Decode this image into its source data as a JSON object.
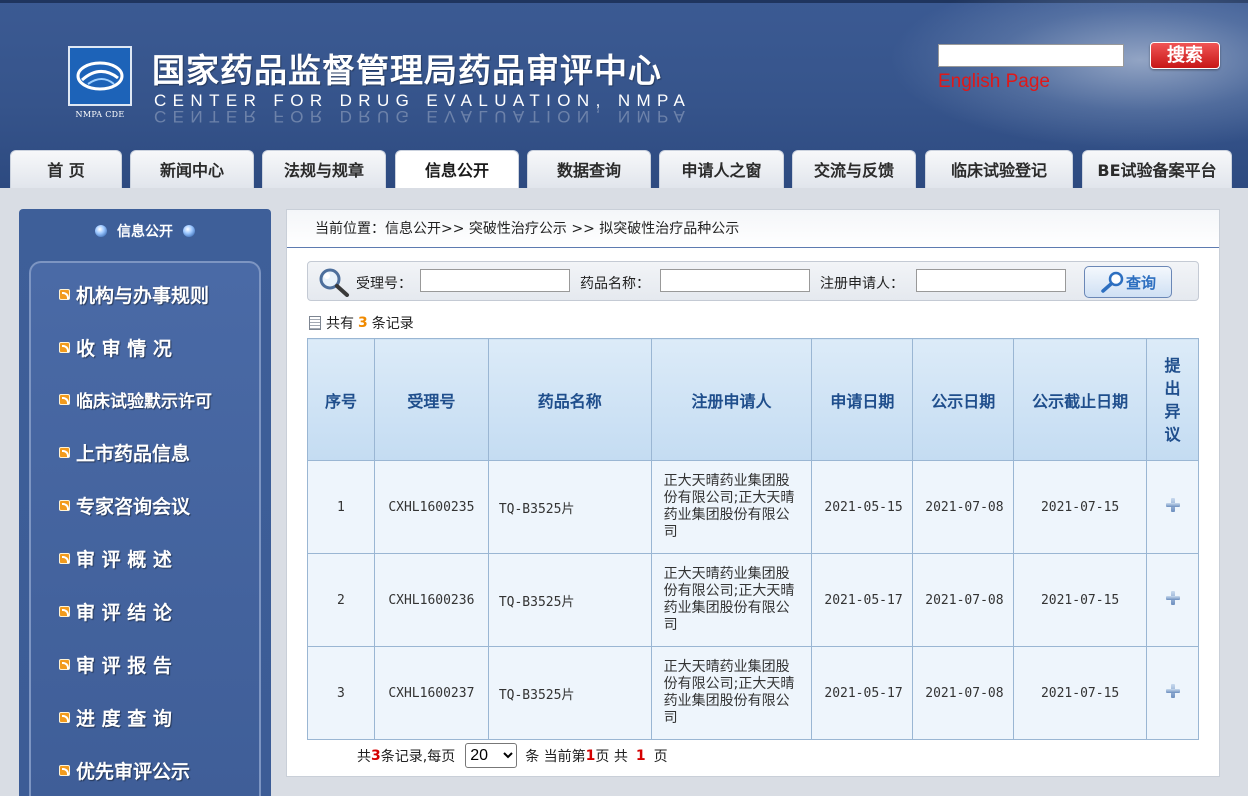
{
  "header": {
    "title": "国家药品监督管理局药品审评中心",
    "subtitle": "CENTER FOR DRUG EVALUATION, NMPA",
    "logo_caption": "NMPA CDE",
    "search_button": "搜索",
    "search_value": "",
    "english_link": "English Page"
  },
  "nav": {
    "tabs": [
      {
        "label": "首  页"
      },
      {
        "label": "新闻中心"
      },
      {
        "label": "法规与规章"
      },
      {
        "label": "信息公开"
      },
      {
        "label": "数据查询"
      },
      {
        "label": "申请人之窗"
      },
      {
        "label": "交流与反馈"
      },
      {
        "label": "临床试验登记"
      },
      {
        "label": "BE试验备案平台"
      }
    ],
    "active": "信息公开"
  },
  "sidebar": {
    "heading": "信息公开",
    "items": [
      {
        "label": "机构与办事规则"
      },
      {
        "label": "收  审  情  况"
      },
      {
        "label": "临床试验默示许可"
      },
      {
        "label": "上市药品信息"
      },
      {
        "label": "专家咨询会议"
      },
      {
        "label": "审  评  概  述"
      },
      {
        "label": "审  评  结  论"
      },
      {
        "label": "审  评  报  告"
      },
      {
        "label": "进  度  查  询"
      },
      {
        "label": "优先审评公示"
      }
    ]
  },
  "main": {
    "breadcrumb": "当前位置：信息公开>> 突破性治疗公示 >> 拟突破性治疗品种公示",
    "query": {
      "label_accept_no": "受理号：",
      "label_drug_name": "药品名称：",
      "label_applicant": "注册申请人：",
      "accept_no_value": "",
      "drug_name_value": "",
      "applicant_value": "",
      "button_label": "查询"
    },
    "count": {
      "prefix": "共有",
      "num": "3",
      "suffix": "条记录"
    },
    "table": {
      "headers": [
        "序号",
        "受理号",
        "药品名称",
        "注册申请人",
        "申请日期",
        "公示日期",
        "公示截止日期",
        "提出异议"
      ],
      "rows": [
        {
          "seq": "1",
          "accept_no": "CXHL1600235",
          "drug": "TQ-B3525片",
          "applicant": "正大天晴药业集团股份有限公司;正大天晴药业集团股份有限公司",
          "apply_date": "2021-05-15",
          "publish_date": "2021-07-08",
          "deadline": "2021-07-15"
        },
        {
          "seq": "2",
          "accept_no": "CXHL1600236",
          "drug": "TQ-B3525片",
          "applicant": "正大天晴药业集团股份有限公司;正大天晴药业集团股份有限公司",
          "apply_date": "2021-05-17",
          "publish_date": "2021-07-08",
          "deadline": "2021-07-15"
        },
        {
          "seq": "3",
          "accept_no": "CXHL1600237",
          "drug": "TQ-B3525片",
          "applicant": "正大天晴药业集团股份有限公司;正大天晴药业集团股份有限公司",
          "apply_date": "2021-05-17",
          "publish_date": "2021-07-08",
          "deadline": "2021-07-15"
        }
      ]
    },
    "pager": {
      "total_prefix": "共",
      "total": "3",
      "total_suffix": "条记录,每页",
      "page_size": "20",
      "current_prefix": "条 当前第",
      "current": "1",
      "current_suffix": "页 共",
      "pages": "1",
      "pages_suffix": "页"
    }
  },
  "colors": {
    "header_bg": "#36548b",
    "search_button": "#d42020",
    "english_link": "#e01818",
    "sidebar_bg": "#3e5f99",
    "table_header_bg": "#c4dcf2",
    "table_header_text": "#1f4e8c",
    "table_cell_bg": "#eef5fc",
    "count_accent": "#f08a00",
    "pager_accent": "#d50000"
  },
  "icons": {
    "logo": "nmpa-logo-icon",
    "query": "magnifier-icon",
    "query_button": "magnifier-icon",
    "sidebar_bullets": "rss-icon",
    "sidebar_heading": "bullet-dot-icon",
    "objection": "plus-icon",
    "record_count": "document-icon"
  }
}
